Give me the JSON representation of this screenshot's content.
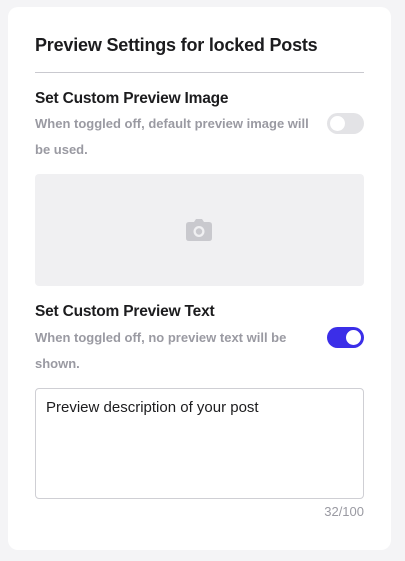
{
  "card": {
    "title": "Preview Settings for locked Posts"
  },
  "preview_image": {
    "title": "Set Custom Preview Image",
    "description": "When toggled off, default preview image will be used.",
    "toggle_on": false,
    "placeholder_icon": "camera-icon"
  },
  "preview_text": {
    "title": "Set Custom Preview Text",
    "description": "When toggled off, no preview text will be shown.",
    "toggle_on": true,
    "value": "Preview description of your post",
    "counter": "32/100"
  },
  "colors": {
    "accent": "#3b2ee8",
    "toggle_off": "#e3e3e6",
    "muted_text": "#9a9aa2"
  }
}
